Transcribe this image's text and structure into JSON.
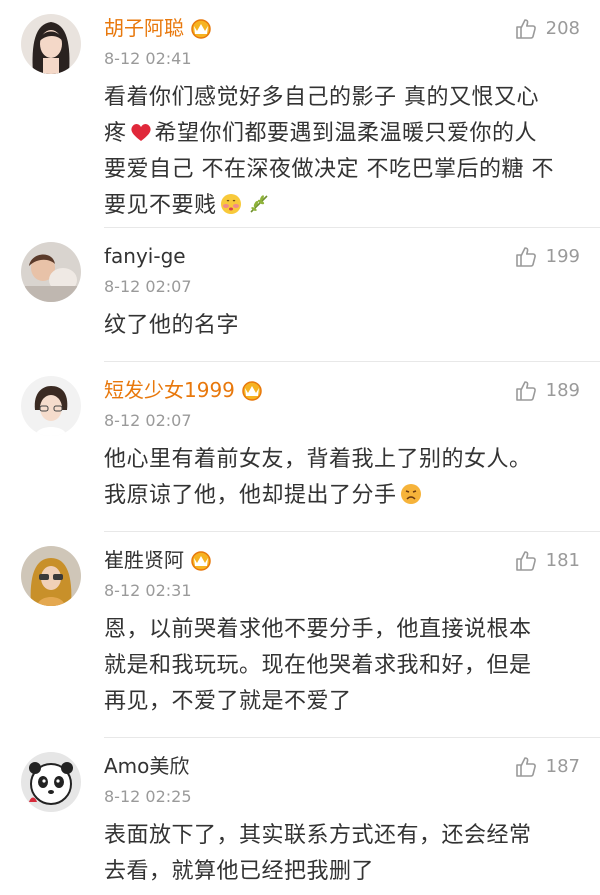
{
  "comments": [
    {
      "username": "胡子阿聪",
      "time": "8-12 02:41",
      "likes": "208",
      "line1": "看着你们感觉好多自己的影子 真的又恨又心",
      "line2a": "疼",
      "line2b": "希望你们都要遇到温柔温暖只爱你的人",
      "line3": "要爱自己 不在深夜做决定 不吃巴掌后的糖 不",
      "line4": "要见不要贱"
    },
    {
      "username": "fanyi-ge",
      "time": "8-12 02:07",
      "likes": "199",
      "line1": "纹了他的名字"
    },
    {
      "username": "短发少女1999",
      "time": "8-12 02:07",
      "likes": "189",
      "line1": "他心里有着前女友，背着我上了别的女人。",
      "line2": "我原谅了他，他却提出了分手"
    },
    {
      "username": "崔胜贤阿",
      "time": "8-12 02:31",
      "likes": "181",
      "line1": "恩，以前哭着求他不要分手，他直接说根本",
      "line2": "就是和我玩玩。现在他哭着求我和好，但是",
      "line3": "再见，不爱了就是不爱了"
    },
    {
      "username": "Amo美欣",
      "time": "8-12 02:25",
      "likes": "187",
      "line1": "表面放下了，其实联系方式还有，还会经常",
      "line2": "去看，就算他已经把我删了"
    }
  ],
  "colors": {
    "vip_name": "#e8780c",
    "meta": "#9a9a9a",
    "text": "#333333"
  },
  "icons": {
    "like": "thumbs-up-icon",
    "vip": "crown-icon",
    "heart": "heart-emoji",
    "shy": "shy-face-emoji",
    "branch": "olive-branch-emoji",
    "upset": "upset-face-emoji"
  }
}
